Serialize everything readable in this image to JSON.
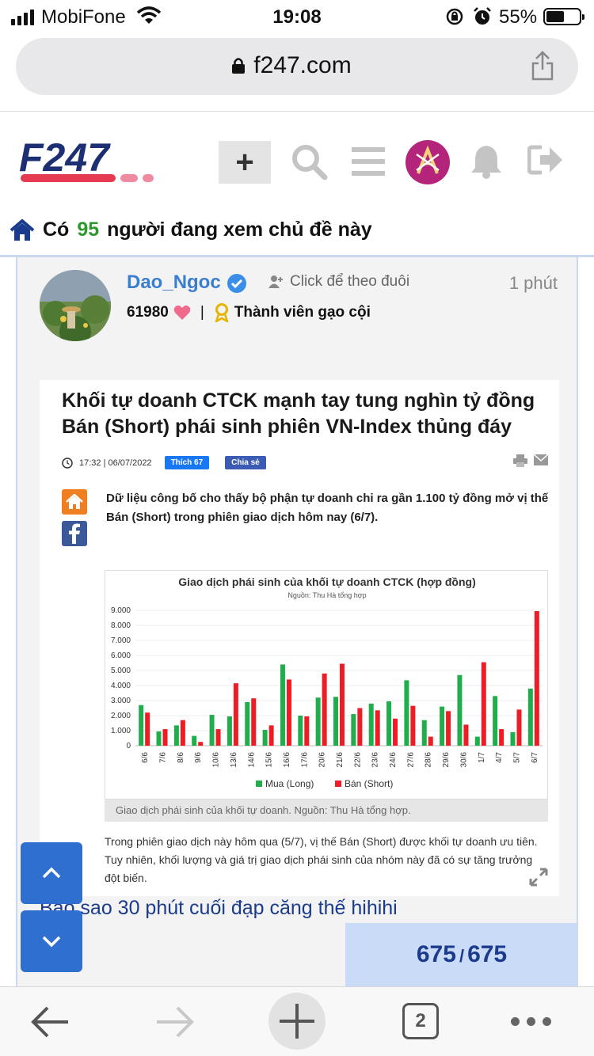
{
  "status_bar": {
    "carrier": "MobiFone",
    "time": "19:08",
    "battery": "55%",
    "battery_level": 0.55
  },
  "browser": {
    "url": "f247.com"
  },
  "header": {
    "logo_text": "F247",
    "brand_color": "#1b2f72",
    "accent_color": "#e63a52"
  },
  "viewers": {
    "prefix": "Có",
    "count": "95",
    "suffix": "người đang xem chủ đề này"
  },
  "post": {
    "username": "Dao_Ngoc",
    "follow_label": "Click để theo đuôi",
    "time_ago": "1 phút",
    "points": "61980",
    "rank": "Thành viên gạo cội",
    "comment": "Bảo sao 30 phút cuối đạp căng thế hihihi"
  },
  "article": {
    "title": "Khối tự doanh CTCK mạnh tay tung nghìn tỷ đồng Bán (Short) phái sinh phiên VN-Index thủng đáy",
    "datetime": "17:32 | 06/07/2022",
    "like_label": "Thích 67",
    "share_label": "Chia sẻ",
    "lead": "Dữ liệu công bố cho thấy bộ phận tự doanh chi ra gần 1.100 tỷ đồng mở vị thế Bán (Short) trong phiên giao dịch hôm nay (6/7).",
    "caption": "Giao dịch phái sinh của khối tự doanh. Nguồn: Thu Hà tổng hợp.",
    "body": "Trong phiên giao dịch này hôm qua (5/7), vị thế Bán (Short) được khối tự doanh ưu tiên. Tuy nhiên, khối lượng và giá trị giao dịch phái sinh của nhóm này đã có sự tăng trưởng đột biến."
  },
  "chart_data": {
    "type": "bar",
    "title": "Giao dịch phái sinh của khối tự doanh CTCK (hợp đồng)",
    "subtitle": "Nguồn: Thu Hà tổng hợp",
    "categories": [
      "6/6",
      "7/6",
      "8/6",
      "9/6",
      "10/6",
      "13/6",
      "14/6",
      "15/6",
      "16/6",
      "17/6",
      "20/6",
      "21/6",
      "22/6",
      "23/6",
      "24/6",
      "27/6",
      "28/6",
      "29/6",
      "30/6",
      "1/7",
      "4/7",
      "5/7",
      "6/7"
    ],
    "series": [
      {
        "name": "Mua (Long)",
        "color": "#1fae4b",
        "values": [
          2700,
          950,
          1350,
          650,
          2050,
          1950,
          2900,
          1050,
          5400,
          2000,
          3200,
          3250,
          2100,
          2800,
          2950,
          4350,
          1700,
          2600,
          4700,
          600,
          3300,
          900,
          3800
        ]
      },
      {
        "name": "Bán (Short)",
        "color": "#ee1c25",
        "values": [
          2200,
          1100,
          1700,
          250,
          1100,
          4150,
          3150,
          1350,
          4400,
          1950,
          4800,
          5450,
          2500,
          2350,
          1800,
          2650,
          600,
          2300,
          1400,
          5550,
          1100,
          2400,
          8950
        ]
      }
    ],
    "ylim": [
      0,
      9000
    ],
    "yticks": [
      "9.000",
      "8.000",
      "7.000",
      "6.000",
      "5.000",
      "4.000",
      "3.000",
      "2.000",
      "1.000",
      "0"
    ],
    "legend_position": "bottom"
  },
  "pager": {
    "current": "675",
    "total": "675"
  }
}
